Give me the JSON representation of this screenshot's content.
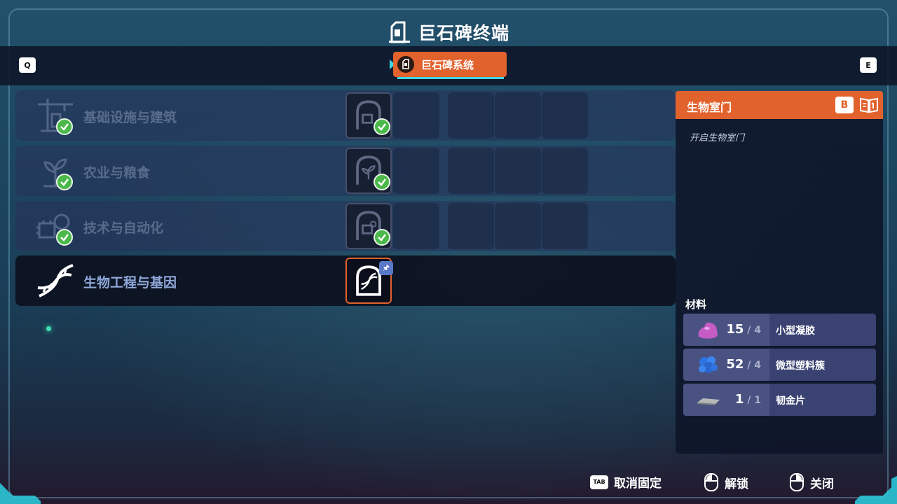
{
  "header": {
    "title": "巨石碑终端",
    "prev_key": "Q",
    "next_key": "E",
    "active_tab": "巨石碑系统"
  },
  "categories": [
    {
      "label": "基础设施与建筑",
      "state": "completed",
      "icon": "crane-building-icon"
    },
    {
      "label": "农业与粮食",
      "state": "completed",
      "icon": "plant-icon"
    },
    {
      "label": "技术与自动化",
      "state": "completed",
      "icon": "gear-chip-icon"
    },
    {
      "label": "生物工程与基因",
      "state": "selected",
      "icon": "dna-icon",
      "pinned": true
    }
  ],
  "detail": {
    "title": "生物室门",
    "key": "B",
    "description": "开启生物室门",
    "materials_label": "材料",
    "materials": [
      {
        "name": "小型凝胶",
        "have": "15",
        "need": "4",
        "icon": "gel-icon",
        "color": "#c55cc6"
      },
      {
        "name": "微型塑料簇",
        "have": "52",
        "need": "4",
        "icon": "plastic-cluster-icon",
        "color": "#2f74e0"
      },
      {
        "name": "韧金片",
        "have": "1",
        "need": "1",
        "icon": "metal-plate-icon",
        "color": "#b7b9b8"
      }
    ],
    "count_separator": "/"
  },
  "footer": {
    "unpin_key": "TAB",
    "unpin_label": "取消固定",
    "unlock_label": "解锁",
    "close_label": "关闭"
  },
  "colors": {
    "accent": "#e2622d",
    "highlight": "#3fd6e0",
    "check": "#4bb84a",
    "panel": "#0e1428"
  }
}
